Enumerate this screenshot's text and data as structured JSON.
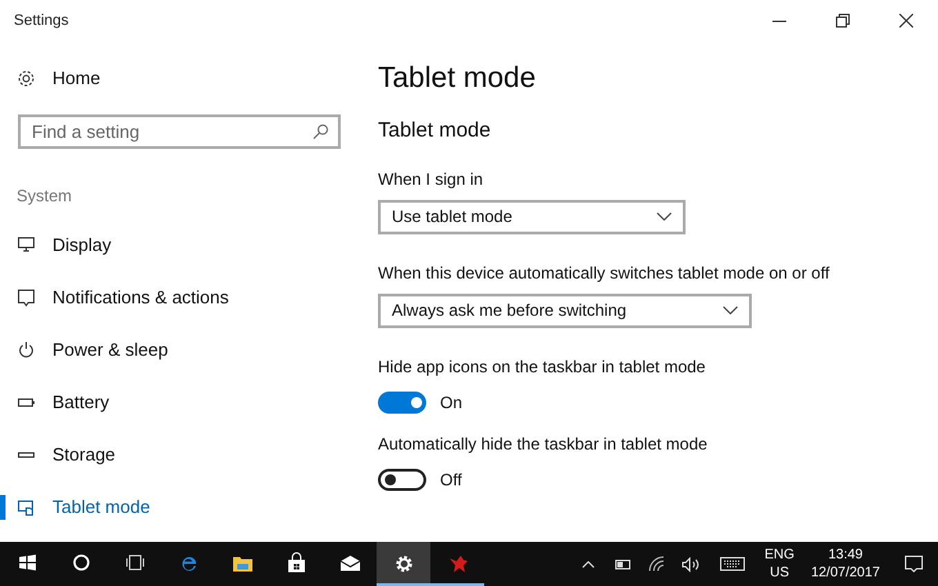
{
  "window": {
    "title": "Settings"
  },
  "sidebar": {
    "home": "Home",
    "search": {
      "placeholder": "Find a setting"
    },
    "section": "System",
    "items": [
      {
        "label": "Display",
        "selected": false
      },
      {
        "label": "Notifications & actions",
        "selected": false
      },
      {
        "label": "Power & sleep",
        "selected": false
      },
      {
        "label": "Battery",
        "selected": false
      },
      {
        "label": "Storage",
        "selected": false
      },
      {
        "label": "Tablet mode",
        "selected": true
      }
    ]
  },
  "content": {
    "title": "Tablet mode",
    "section": "Tablet mode",
    "settings": [
      {
        "kind": "dropdown",
        "label": "When I sign in",
        "value": "Use tablet mode"
      },
      {
        "kind": "dropdown",
        "label": "When this device automatically switches tablet mode on or off",
        "value": "Always ask me before switching"
      },
      {
        "kind": "toggle",
        "label": "Hide app icons on the taskbar in tablet mode",
        "on": true,
        "state": "On"
      },
      {
        "kind": "toggle",
        "label": "Automatically hide the taskbar in tablet mode",
        "on": false,
        "state": "Off"
      }
    ]
  },
  "taskbar": {
    "apps": [
      {
        "open": false,
        "selected": false
      },
      {
        "open": false,
        "selected": false
      },
      {
        "open": false,
        "selected": false
      },
      {
        "open": false,
        "selected": false
      },
      {
        "open": false,
        "selected": false
      },
      {
        "open": false,
        "selected": false
      },
      {
        "open": false,
        "selected": false
      },
      {
        "open": true,
        "selected": true
      },
      {
        "open": true,
        "selected": false
      }
    ],
    "language": "ENG",
    "region": "US",
    "time": "13:49",
    "date": "12/07/2017"
  }
}
